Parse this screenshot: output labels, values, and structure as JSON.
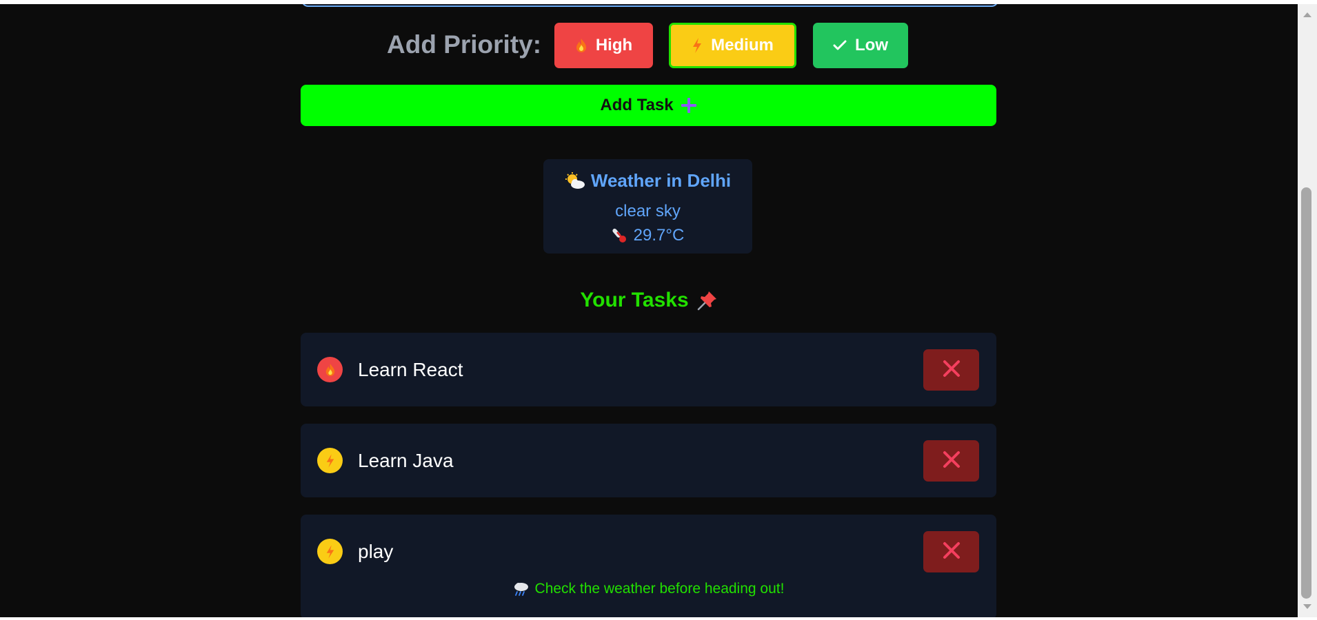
{
  "priority": {
    "label": "Add Priority:",
    "options": [
      {
        "label": "High",
        "icon": "fire-icon",
        "color": "#ef4444"
      },
      {
        "label": "Medium",
        "icon": "lightning-icon",
        "color": "#facc15",
        "selected": true
      },
      {
        "label": "Low",
        "icon": "check-icon",
        "color": "#22c55e"
      }
    ]
  },
  "add_task": {
    "label": "Add Task",
    "icon": "plus-icon",
    "color": "#00ff00"
  },
  "weather": {
    "title": "Weather in Delhi",
    "icon": "sun-behind-cloud-icon",
    "description": "clear sky",
    "temperature": "29.7°C",
    "temp_icon": "thermometer-icon"
  },
  "tasks_heading": {
    "label": "Your Tasks",
    "icon": "pushpin-icon"
  },
  "tasks": [
    {
      "name": "Learn React",
      "priority": "high",
      "priority_icon": "fire-icon"
    },
    {
      "name": "Learn Java",
      "priority": "medium",
      "priority_icon": "lightning-icon"
    },
    {
      "name": "play",
      "priority": "medium",
      "priority_icon": "lightning-icon",
      "tip": "Check the weather before heading out!",
      "tip_icon": "rain-cloud-icon"
    }
  ],
  "colors": {
    "background": "#0c0c0c",
    "card": "#111827",
    "accent_green": "#22e000",
    "weather_blue": "#60a5fa",
    "delete_bg": "#7f1d1d",
    "delete_x": "#f43f5e"
  }
}
